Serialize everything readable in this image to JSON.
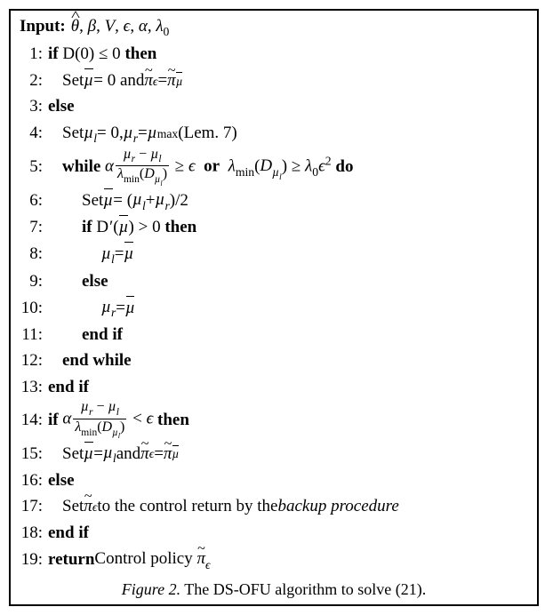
{
  "input": {
    "label": "Input:",
    "params": "θ̂, β, V, ϵ, α, λ₀"
  },
  "lines": {
    "l1": {
      "num": "1:",
      "kw": "if",
      "cond_html": "<span class='cal'>D</span>(0) ≤ 0",
      "kw2": "then"
    },
    "l2": {
      "num": "2:",
      "text_html": "Set <span class='accent bar ital'>µ</span> = 0 and <span class='accent tilde ital'>π</span><span class='sub ital'>ϵ</span> = <span class='accent tilde ital'>π</span><span class='sub'><span class='accent bar ital' style='font-size:1em'>µ</span></span>"
    },
    "l3": {
      "num": "3:",
      "kw": "else"
    },
    "l4": {
      "num": "4:",
      "text_html": "Set <span class='ital'>µ<span class='sub'>l</span></span> = 0, <span class='ital'>µ<span class='sub'>r</span></span> = <span class='ital'>µ</span><span class='sub'>max</span> (Lem. 7)"
    },
    "l5": {
      "num": "5:",
      "kw": "while",
      "cond_html": "<span class='ital'>α</span><span class='frac'><span class='num'><span class='ital'>µ<span class='sub'>r</span></span> − <span class='ital'>µ<span class='sub'>l</span></span></span><span class='den'><span class='ital'>λ</span><span class='sub'>min</span>(<span class='ital'>D<span class='sub'>µ<span class='sub'>l</span></span></span>)</span></span> ≥ <span class='ital'>ϵ</span> &nbsp;<span class='kw'>or</span>&nbsp; <span class='ital'>λ</span><span class='sub'>min</span>(<span class='ital'>D<span class='sub'>µ<span class='sub'>l</span></span></span>) ≥ <span class='ital'>λ</span><span class='sub'>0</span><span class='ital'>ϵ</span><span class='sup'>2</span>",
      "kw2": "do"
    },
    "l6": {
      "num": "6:",
      "text_html": "Set <span class='accent bar ital'>µ</span> = (<span class='ital'>µ<span class='sub'>l</span></span> + <span class='ital'>µ<span class='sub'>r</span></span>)/2"
    },
    "l7": {
      "num": "7:",
      "kw": "if",
      "cond_html": "<span class='cal'>D</span><span class='prime'>′</span>(<span class='accent bar ital'>µ</span>) &gt; 0",
      "kw2": "then"
    },
    "l8": {
      "num": "8:",
      "text_html": "<span class='ital'>µ<span class='sub'>l</span></span> = <span class='accent bar ital'>µ</span>"
    },
    "l9": {
      "num": "9:",
      "kw": "else"
    },
    "l10": {
      "num": "10:",
      "text_html": "<span class='ital'>µ<span class='sub'>r</span></span> = <span class='accent bar ital'>µ</span>"
    },
    "l11": {
      "num": "11:",
      "kw": "end if"
    },
    "l12": {
      "num": "12:",
      "kw": "end while"
    },
    "l13": {
      "num": "13:",
      "kw": "end if"
    },
    "l14": {
      "num": "14:",
      "kw": "if",
      "cond_html": "<span class='ital'>α</span><span class='frac'><span class='num'><span class='ital'>µ<span class='sub'>r</span></span> − <span class='ital'>µ<span class='sub'>l</span></span></span><span class='den'><span class='ital'>λ</span><span class='sub'>min</span>(<span class='ital'>D<span class='sub'>µ<span class='sub'>l</span></span></span>)</span></span> &lt; <span class='ital'>ϵ</span>",
      "kw2": "then"
    },
    "l15": {
      "num": "15:",
      "text_html": "Set <span class='accent bar ital'>µ</span> = <span class='ital'>µ<span class='sub'>l</span></span> and <span class='accent tilde ital'>π</span><span class='sub ital'>ϵ</span> = <span class='accent tilde ital'>π</span><span class='sub'><span class='accent bar ital' style='font-size:1em'>µ</span></span>"
    },
    "l16": {
      "num": "16:",
      "kw": "else"
    },
    "l17": {
      "num": "17:",
      "text_html": "Set <span class='accent tilde ital'>π</span><span class='sub ital'>ϵ</span> to the control return by the <span class='ital'>backup procedure</span>"
    },
    "l18": {
      "num": "18:",
      "kw": "end if"
    },
    "l19": {
      "num": "19:",
      "kw": "return",
      "text_html": " Control policy <span class='accent tilde ital'>π</span><span class='sub ital'>ϵ</span>"
    }
  },
  "caption": {
    "fignum": "Figure 2.",
    "text": " The DS-OFU algorithm to solve (21)."
  }
}
